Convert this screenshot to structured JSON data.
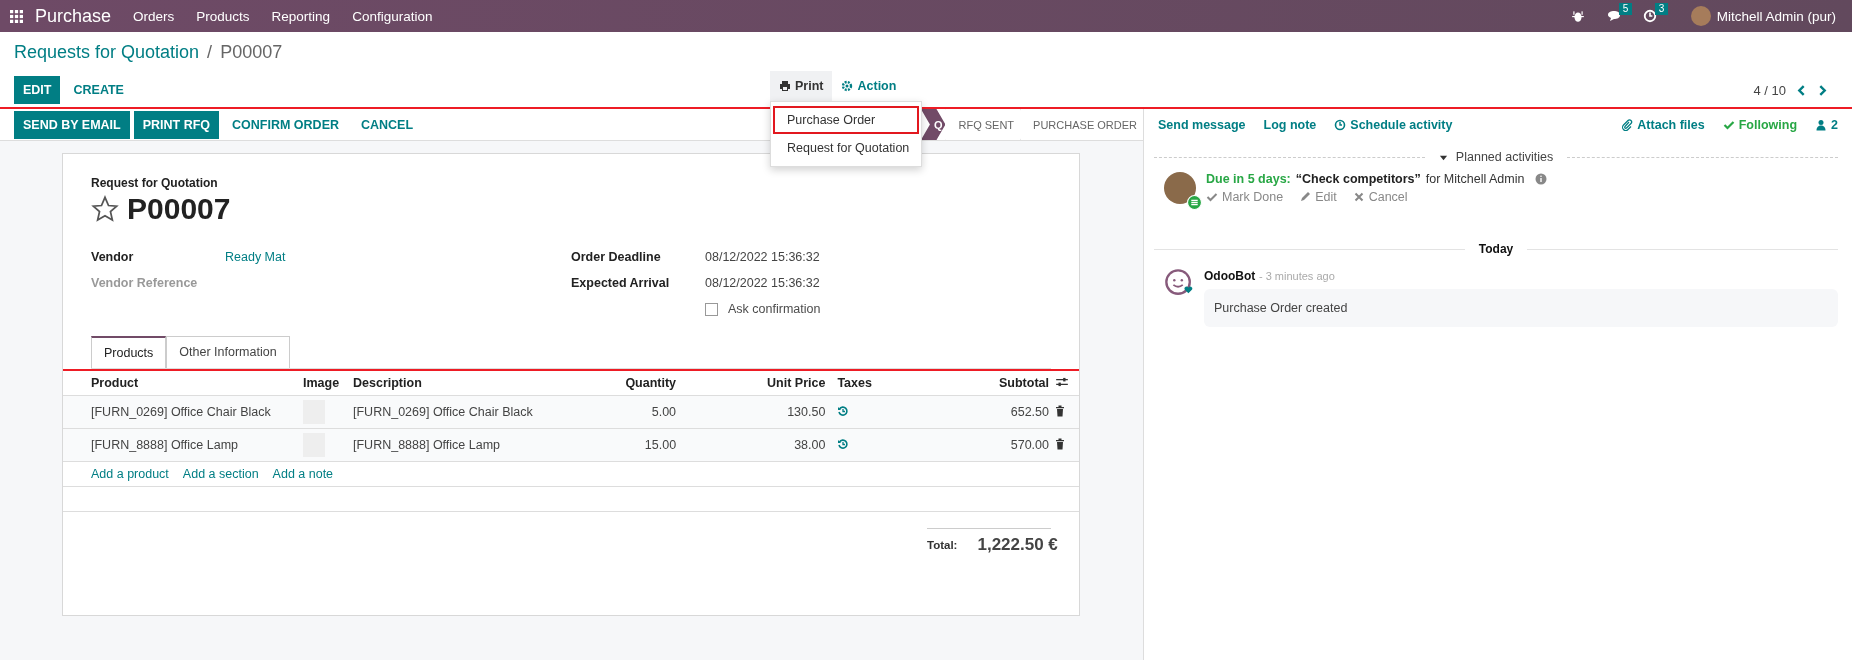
{
  "navbar": {
    "app": "Purchase",
    "menus": [
      "Orders",
      "Products",
      "Reporting",
      "Configuration"
    ],
    "messages_count": "5",
    "activities_count": "3",
    "user": "Mitchell Admin (pur)"
  },
  "breadcrumb": {
    "parent": "Requests for Quotation",
    "separator": "/",
    "current": "P00007"
  },
  "control_buttons": [
    {
      "label": "EDIT",
      "kind": "primary"
    },
    {
      "label": "CREATE",
      "kind": "link"
    }
  ],
  "print_menu": {
    "label": "Print",
    "items": [
      {
        "label": "Purchase Order",
        "highlighted": true
      },
      {
        "label": "Request for Quotation",
        "highlighted": false
      }
    ]
  },
  "action_label": "Action",
  "pager": "4 / 10",
  "header_buttons": [
    {
      "label": "SEND BY EMAIL",
      "kind": "primary"
    },
    {
      "label": "PRINT RFQ",
      "kind": "primary"
    },
    {
      "label": "CONFIRM ORDER",
      "kind": "link"
    },
    {
      "label": "CANCEL",
      "kind": "link"
    }
  ],
  "statuses": [
    {
      "label": "Q",
      "selected": true
    },
    {
      "label": "RFQ SENT",
      "selected": false
    },
    {
      "label": "PURCHASE ORDER",
      "selected": false
    }
  ],
  "form": {
    "type_label": "Request for Quotation",
    "name": "P00007",
    "starred": false,
    "fields_left": [
      {
        "label": "Vendor",
        "value": "Ready Mat",
        "empty": false
      },
      {
        "label": "Vendor Reference",
        "empty": true
      }
    ],
    "fields_right": [
      {
        "label": "Order Deadline",
        "value": "08/12/2022 15:36:32"
      },
      {
        "label": "Expected Arrival",
        "value": "08/12/2022 15:36:32"
      }
    ],
    "ask_confirmation": {
      "label": "Ask confirmation",
      "checked": false
    }
  },
  "tabs": [
    {
      "label": "Products",
      "selected": true
    },
    {
      "label": "Other Information",
      "selected": false
    }
  ],
  "table": {
    "columns": [
      "Product",
      "Image",
      "Description",
      "Quantity",
      "Unit Price",
      "Taxes",
      "Subtotal"
    ],
    "rows": [
      {
        "product": "[FURN_0269] Office Chair Black",
        "description": "[FURN_0269] Office Chair Black",
        "quantity": "5.00",
        "unit_price": "130.50",
        "subtotal": "652.50"
      },
      {
        "product": "[FURN_8888] Office Lamp",
        "description": "[FURN_8888] Office Lamp",
        "quantity": "15.00",
        "unit_price": "38.00",
        "subtotal": "570.00"
      }
    ],
    "add_links": [
      "Add a product",
      "Add a section",
      "Add a note"
    ]
  },
  "total": {
    "label": "Total:",
    "value": "1,222.50 €"
  },
  "chatter": {
    "buttons": [
      "Send message",
      "Log note",
      "Schedule activity"
    ],
    "attach": "Attach files",
    "following": "Following",
    "followers": "2",
    "planned_label": "Planned activities",
    "planned_expanded": true,
    "activity": {
      "due": "Due in 5 days:",
      "summary": "“Check competitors”",
      "assignee": "for Mitchell Admin",
      "actions": [
        "Mark Done",
        "Edit",
        "Cancel"
      ]
    },
    "date_separator": "Today",
    "message": {
      "author": "OdooBot",
      "time": "- 3 minutes ago",
      "body": "Purchase Order created"
    }
  }
}
